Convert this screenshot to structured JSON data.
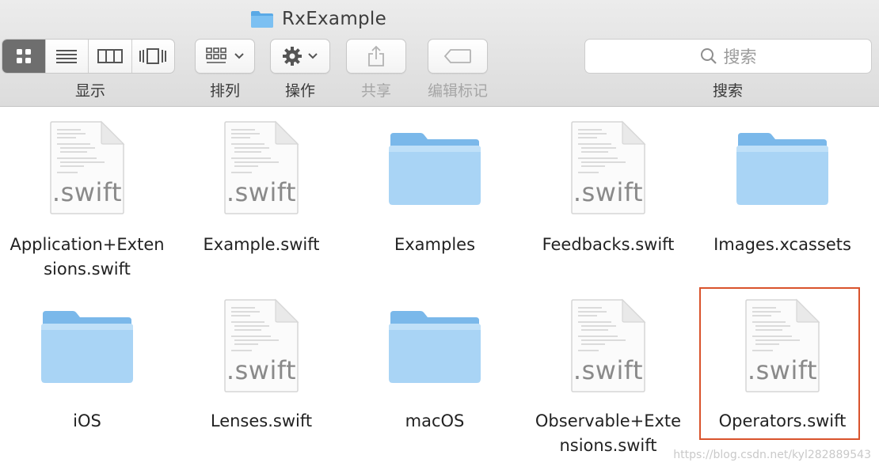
{
  "window": {
    "title": "RxExample"
  },
  "toolbar": {
    "view_buttons": [
      {
        "icon": "icon-view-icon",
        "active": true
      },
      {
        "icon": "list-view-icon",
        "active": false
      },
      {
        "icon": "column-view-icon",
        "active": false
      },
      {
        "icon": "cover-flow-icon",
        "active": false
      }
    ],
    "view_label": "显示",
    "arrange_label": "排列",
    "action_label": "操作",
    "share_label": "共享",
    "tags_label": "编辑标记",
    "search_placeholder": "搜索",
    "search_label": "搜索"
  },
  "files": [
    {
      "name": "Application+Exten\nsions.swift",
      "kind": "swift",
      "ext": ".swift",
      "selected": false
    },
    {
      "name": "Example.swift",
      "kind": "swift",
      "ext": ".swift",
      "selected": false
    },
    {
      "name": "Examples",
      "kind": "folder",
      "selected": false
    },
    {
      "name": "Feedbacks.swift",
      "kind": "swift",
      "ext": ".swift",
      "selected": false
    },
    {
      "name": "Images.xcassets",
      "kind": "folder",
      "selected": false
    },
    {
      "name": "iOS",
      "kind": "folder",
      "selected": false
    },
    {
      "name": "Lenses.swift",
      "kind": "swift",
      "ext": ".swift",
      "selected": false
    },
    {
      "name": "macOS",
      "kind": "folder",
      "selected": false
    },
    {
      "name": "Observable+Exte\nnsions.swift",
      "kind": "swift",
      "ext": ".swift",
      "selected": false
    },
    {
      "name": "Operators.swift",
      "kind": "swift",
      "ext": ".swift",
      "selected": true
    }
  ],
  "watermark": "https://blog.csdn.net/kyl282889543",
  "colors": {
    "folder_light": "#a9d4f5",
    "folder_dark": "#7ab8ea",
    "selection_border": "#d9532c",
    "toolbar_bg": "#e2e2e2"
  }
}
